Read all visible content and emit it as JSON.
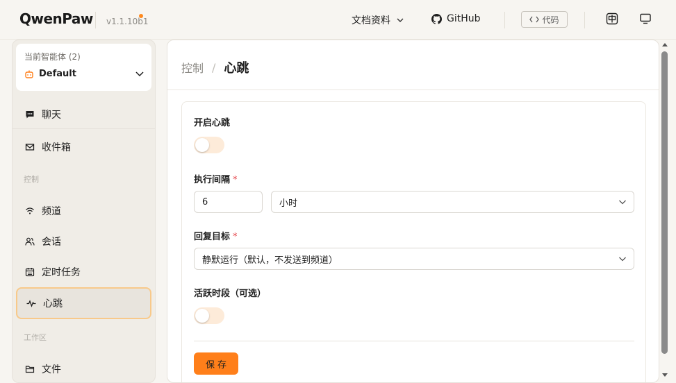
{
  "header": {
    "logo": "QwenPaw",
    "version": "v1.1.10b1",
    "docs_label": "文档资料",
    "github_label": "GitHub",
    "code_label": "代码",
    "accent_color": "#ff7f1a"
  },
  "sidebar": {
    "agent_caption": "当前智能体 (2)",
    "agent_name": "Default",
    "items": [
      {
        "label": "聊天",
        "icon": "chat-icon"
      },
      {
        "label": "收件箱",
        "icon": "mail-icon"
      }
    ],
    "group_control": "控制",
    "control_items": [
      {
        "label": "频道",
        "icon": "wifi-icon"
      },
      {
        "label": "会话",
        "icon": "users-icon"
      },
      {
        "label": "定时任务",
        "icon": "calendar-icon"
      },
      {
        "label": "心跳",
        "icon": "pulse-icon",
        "active": true
      }
    ],
    "group_workspace": "工作区",
    "workspace_items": [
      {
        "label": "文件",
        "icon": "folder-icon"
      }
    ]
  },
  "main": {
    "breadcrumb_parent": "控制",
    "breadcrumb_sep": "/",
    "title": "心跳",
    "form": {
      "enable_label": "开启心跳",
      "enable_on": false,
      "interval_label": "执行间隔",
      "required_mark": "*",
      "interval_value": "6",
      "interval_unit": "小时",
      "target_label": "回复目标",
      "target_value": "静默运行（默认，不发送到频道）",
      "active_period_label": "活跃时段（可选）",
      "active_period_on": false,
      "save_label": "保存"
    }
  }
}
